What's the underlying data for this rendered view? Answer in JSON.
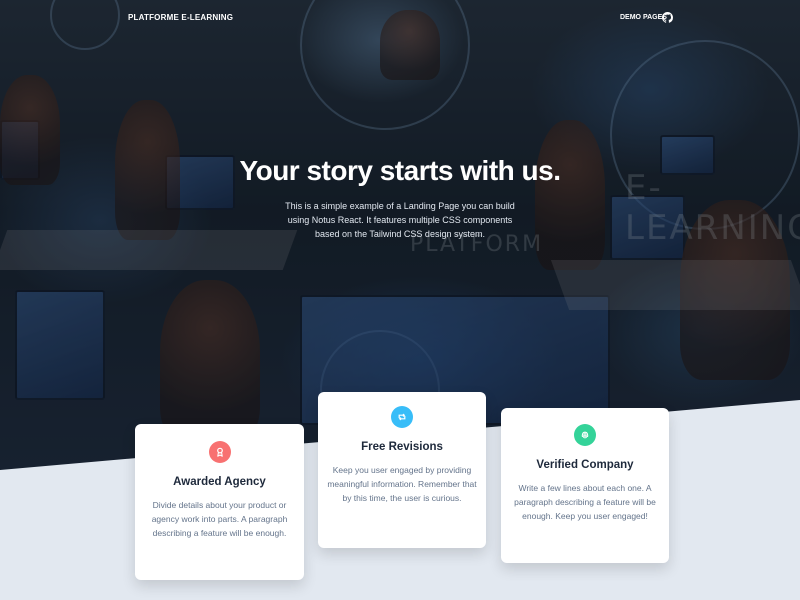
{
  "nav": {
    "brand": "PLATFORME E-LEARNING",
    "demo_pages": "DEMO PAGES"
  },
  "hero": {
    "title": "Your story starts with us.",
    "description": "This is a simple example of a Landing Page you can build using Notus React. It features multiple CSS components based on the Tailwind CSS design system.",
    "background_word_1": "E-LEARNING",
    "background_word_2": "PLATFORM"
  },
  "cards": [
    {
      "title": "Awarded Agency",
      "text": "Divide details about your product or agency work into parts. A paragraph describing a feature will be enough.",
      "icon": "award-icon",
      "color": "#f87171"
    },
    {
      "title": "Free Revisions",
      "text": "Keep you user engaged by providing meaningful information. Remember that by this time, the user is curious.",
      "icon": "retweet-icon",
      "color": "#38bdf8"
    },
    {
      "title": "Verified Company",
      "text": "Write a few lines about each one. A paragraph describing a feature will be enough. Keep you user engaged!",
      "icon": "fingerprint-icon",
      "color": "#34d399"
    }
  ],
  "colors": {
    "page_background": "#e2e8f0",
    "card_background": "#ffffff",
    "title": "#1e293b",
    "body_text": "#64748b"
  }
}
